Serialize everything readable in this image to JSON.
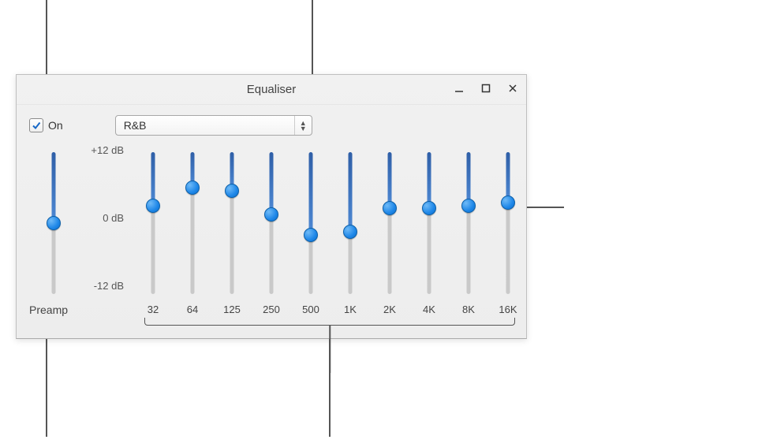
{
  "window": {
    "title": "Equaliser"
  },
  "on": {
    "checked": true,
    "label": "On"
  },
  "preset": {
    "selected": "R&B"
  },
  "db_scale": {
    "max_label": "+12 dB",
    "mid_label": "0 dB",
    "min_label": "-12 dB",
    "max": 12,
    "min": -12
  },
  "preamp": {
    "label": "Preamp",
    "value_db": 0
  },
  "bands": [
    {
      "freq_label": "32",
      "value_db": 3.0
    },
    {
      "freq_label": "64",
      "value_db": 6.0
    },
    {
      "freq_label": "125",
      "value_db": 5.5
    },
    {
      "freq_label": "250",
      "value_db": 1.5
    },
    {
      "freq_label": "500",
      "value_db": -2.0
    },
    {
      "freq_label": "1K",
      "value_db": -1.5
    },
    {
      "freq_label": "2K",
      "value_db": 2.5
    },
    {
      "freq_label": "4K",
      "value_db": 2.5
    },
    {
      "freq_label": "8K",
      "value_db": 3.0
    },
    {
      "freq_label": "16K",
      "value_db": 3.5
    }
  ]
}
